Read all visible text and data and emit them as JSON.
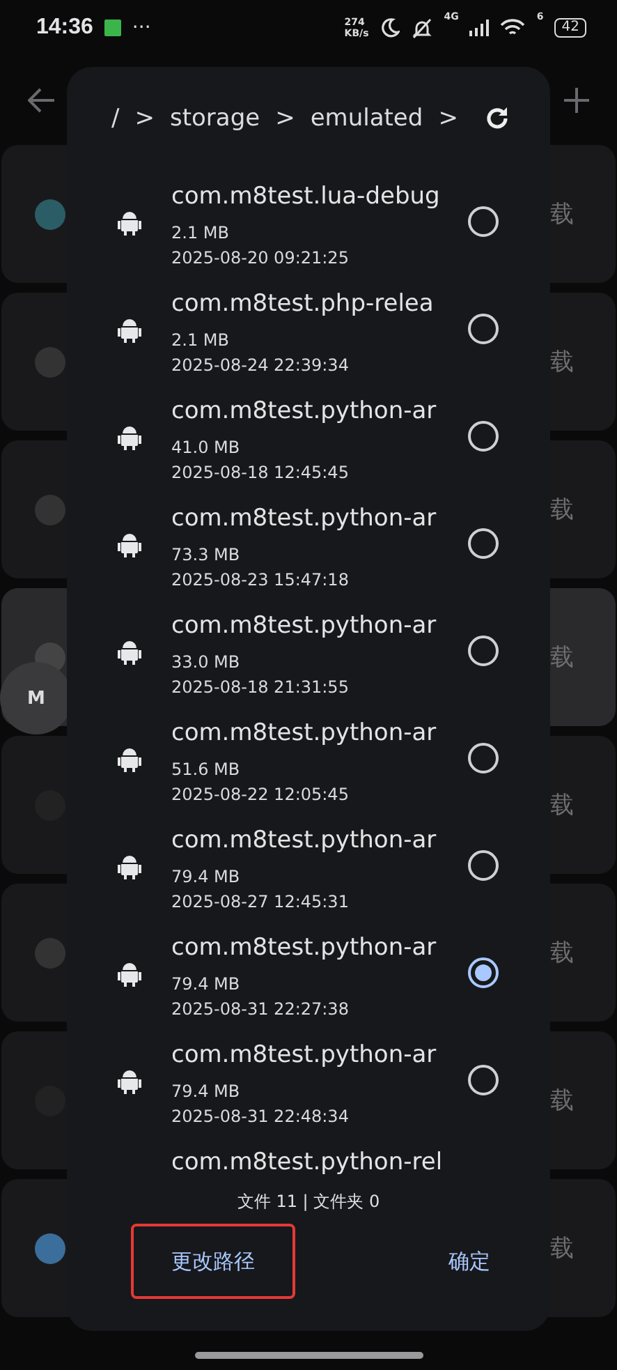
{
  "status_bar": {
    "time": "14:36",
    "more": "···",
    "net_speed": "274",
    "net_unit": "KB/s",
    "network": "4G",
    "wifi_label": "6",
    "battery": "42"
  },
  "background_cards": [
    {
      "action": "载",
      "selected": false
    },
    {
      "action": "载",
      "selected": false
    },
    {
      "action": "载",
      "selected": false
    },
    {
      "action": "载",
      "selected": true
    },
    {
      "action": "载",
      "selected": false
    },
    {
      "action": "载",
      "selected": false
    },
    {
      "action": "载",
      "selected": false
    },
    {
      "action": "载",
      "selected": false
    }
  ],
  "floating_button": {
    "label": "M"
  },
  "dialog": {
    "breadcrumb": [
      "/",
      "storage",
      "emulated"
    ],
    "separator": ">",
    "files": [
      {
        "name": "com.m8test.lua-debug",
        "size": "2.1 MB",
        "date": "2025-08-20 09:21:25",
        "selected": false
      },
      {
        "name": "com.m8test.php-relea",
        "size": "2.1 MB",
        "date": "2025-08-24 22:39:34",
        "selected": false
      },
      {
        "name": "com.m8test.python-ar",
        "size": "41.0 MB",
        "date": "2025-08-18 12:45:45",
        "selected": false
      },
      {
        "name": "com.m8test.python-ar",
        "size": "73.3 MB",
        "date": "2025-08-23 15:47:18",
        "selected": false
      },
      {
        "name": "com.m8test.python-ar",
        "size": "33.0 MB",
        "date": "2025-08-18 21:31:55",
        "selected": false
      },
      {
        "name": "com.m8test.python-ar",
        "size": "51.6 MB",
        "date": "2025-08-22 12:05:45",
        "selected": false
      },
      {
        "name": "com.m8test.python-ar",
        "size": "79.4 MB",
        "date": "2025-08-27 12:45:31",
        "selected": false
      },
      {
        "name": "com.m8test.python-ar",
        "size": "79.4 MB",
        "date": "2025-08-31 22:27:38",
        "selected": true
      },
      {
        "name": "com.m8test.python-ar",
        "size": "79.4 MB",
        "date": "2025-08-31 22:48:34",
        "selected": false
      },
      {
        "name": "com.m8test.python-rel"
      }
    ],
    "summary": "文件 11 | 文件夹 0",
    "buttons": [
      {
        "label": "更改路径",
        "highlighted": true
      },
      {
        "label": "确定",
        "highlighted": false
      }
    ]
  }
}
